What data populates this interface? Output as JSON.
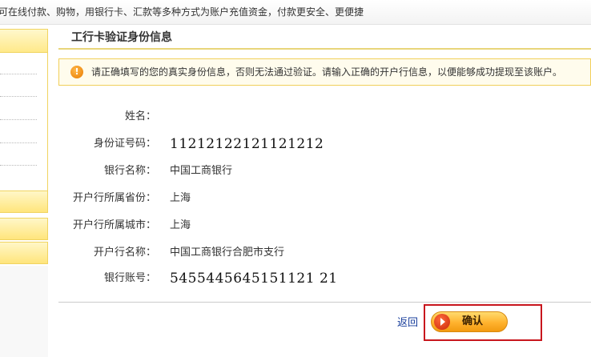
{
  "top_banner": {
    "text": "可在线付款、购物，用银行卡、汇款等多种方式为账户充值资金，付款更安全、更便捷"
  },
  "panel": {
    "title": "工行卡验证身份信息"
  },
  "notice": {
    "icon": "exclamation-icon",
    "text": "请正确填写的您的真实身份信息，否则无法通过验证。请输入正确的开户行信息，以便能够成功提现至该账户。"
  },
  "fields": {
    "name": {
      "label": "姓名：",
      "value": ""
    },
    "id_number": {
      "label": "身份证号码：",
      "value": "11212122121121212"
    },
    "bank_name": {
      "label": "银行名称：",
      "value": "中国工商银行"
    },
    "province": {
      "label": "开户行所属省份：",
      "value": "上海"
    },
    "city": {
      "label": "开户行所属城市：",
      "value": "上海"
    },
    "branch": {
      "label": "开户行名称：",
      "value": "中国工商银行合肥市支行"
    },
    "account": {
      "label": "银行账号：",
      "value": "5455445645151121 21"
    }
  },
  "actions": {
    "back_label": "返回",
    "confirm_label": "确认"
  },
  "colors": {
    "accent_yellow": "#ffe57c",
    "highlight_red": "#c8161d",
    "link_blue": "#1a3f9c",
    "button_orange": "#ffb22e"
  }
}
